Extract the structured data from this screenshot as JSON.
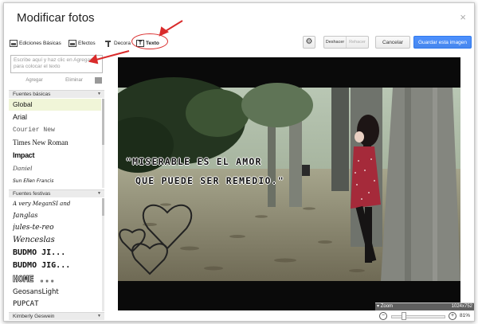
{
  "dialog": {
    "title": "Modificar fotos",
    "close_glyph": "×"
  },
  "tabs": [
    {
      "label": "Ediciones Básicas",
      "icon": "basic-edits-icon"
    },
    {
      "label": "Efectos",
      "icon": "effects-icon"
    },
    {
      "label": "Decora",
      "icon": "decorations-icon"
    },
    {
      "label": "Texto",
      "icon": "text-icon",
      "active": true
    }
  ],
  "toolbar": {
    "settings_icon": "gear-icon",
    "settings_glyph": "⚙",
    "undo_label": "Deshacer",
    "redo_label": "Rehacer",
    "cancel_label": "Cancelar",
    "save_label": "Guardar esta imagen"
  },
  "text_panel": {
    "input_placeholder": "Escribe aquí y haz clic en Agregar para colocar el texto",
    "add_label": "Agregar",
    "delete_label": "Eliminar"
  },
  "sections": {
    "basic_title": "Fuentes básicas",
    "festive_title": "Fuentes festivas",
    "last_title": "Kimberly Geswein",
    "triangle": "▼"
  },
  "basic_fonts": [
    "Global",
    "Arial",
    "Courier New",
    "Times New Roman",
    "Impact",
    "Daniel",
    "Sun Ellen Francis"
  ],
  "festive_fonts": [
    "A very MeganSI and",
    "Janglas",
    "jules-te-reo",
    "Wenceslas",
    "BUDMO JI...",
    "BUDMO JIG...",
    "HOME ...",
    "GeosansLight",
    "PUPCAT"
  ],
  "photo": {
    "caption_line1": "\"MISERABLE ES EL AMOR",
    "caption_line2": "QUE PUEDE SER REMEDIO.\""
  },
  "zoom": {
    "label": "Zoom",
    "dimensions": "1024x752",
    "percent": "81%",
    "level_fraction": 0.2
  },
  "colors": {
    "accent_blue": "#4d90fe",
    "annotation_red": "#d92b2b",
    "selected_font_bg": "#f0f5d8"
  }
}
